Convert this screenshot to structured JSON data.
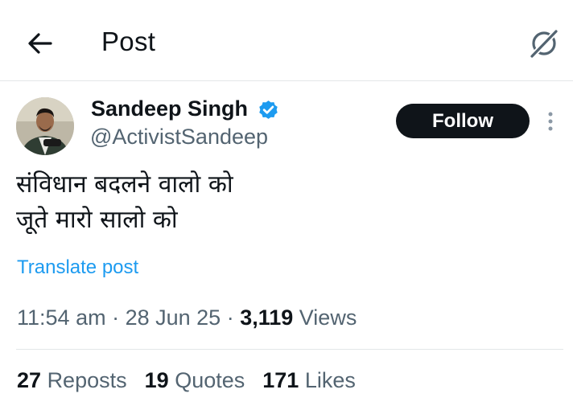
{
  "header": {
    "title": "Post",
    "back_icon": "arrow-left-icon",
    "grok_icon": "grok-icon"
  },
  "author": {
    "name": "Sandeep Singh",
    "handle": "@ActivistSandeep",
    "verified_badge": "verified-badge-icon",
    "verified_color": "#1d9bf0"
  },
  "actions": {
    "follow_label": "Follow",
    "more_icon": "more-vertical-icon"
  },
  "post": {
    "lines": [
      "संविधान बदलने वालो को",
      "जूते मारो सालो को"
    ],
    "translate_label": "Translate post"
  },
  "meta": {
    "time": "11:54 am",
    "separator": " · ",
    "date": "28 Jun 25",
    "views_count": "3,119",
    "views_label": "Views"
  },
  "stats": {
    "reposts_count": "27",
    "reposts_label": "Reposts",
    "quotes_count": "19",
    "quotes_label": "Quotes",
    "likes_count": "171",
    "likes_label": "Likes"
  },
  "colors": {
    "text_primary": "#0f1419",
    "text_secondary": "#536471",
    "link": "#1d9bf0",
    "divider": "#e3e6e8"
  }
}
